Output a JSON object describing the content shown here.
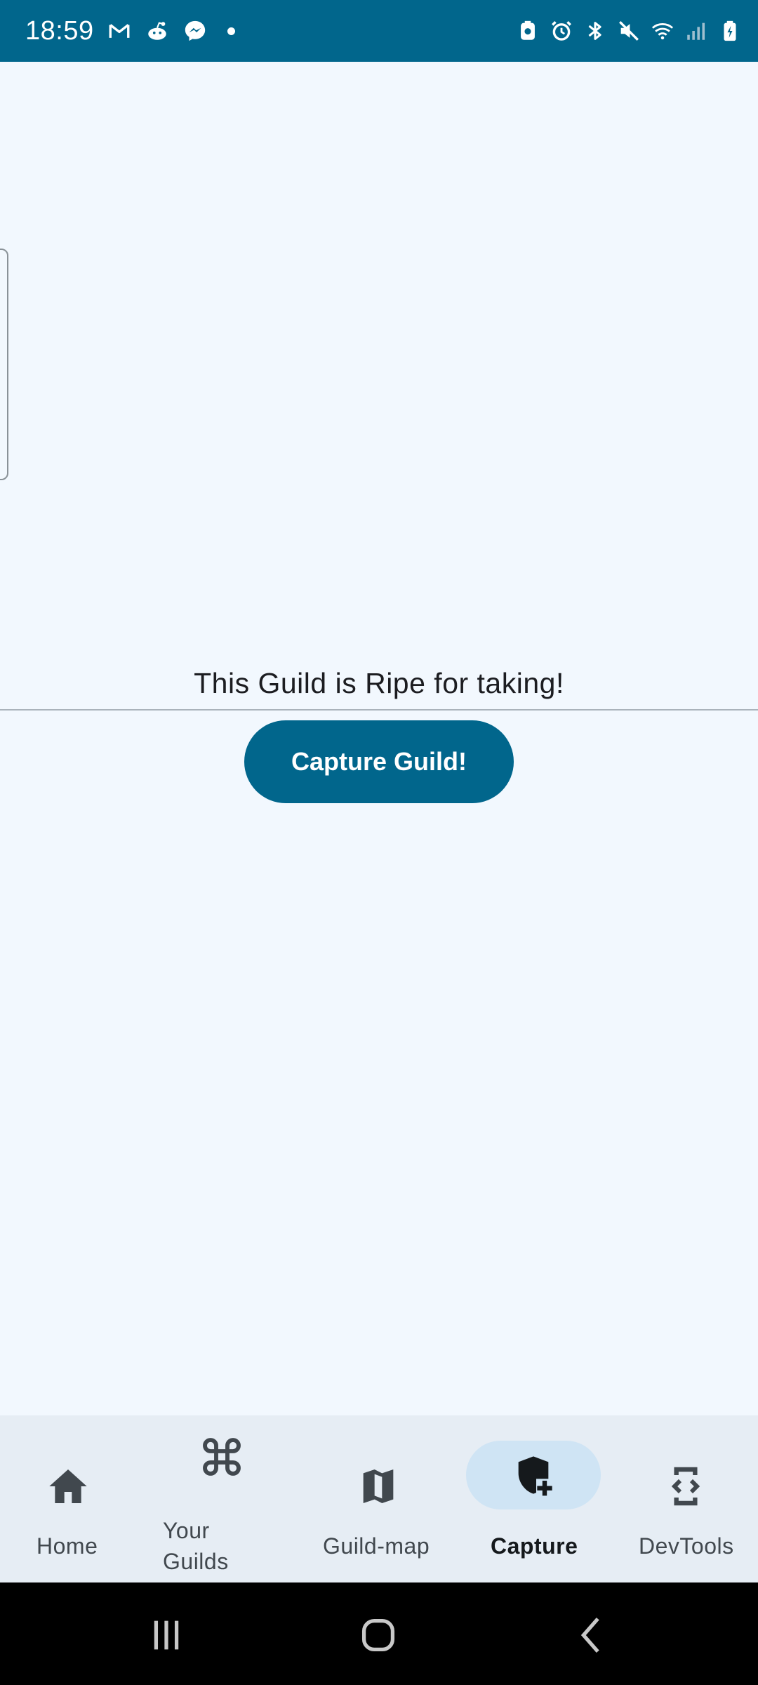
{
  "status_bar": {
    "time": "18:59",
    "left_icons": [
      "gmail-icon",
      "reddit-icon",
      "messenger-icon",
      "notification-dot-icon"
    ],
    "right_icons": [
      "screenshot-icon",
      "alarm-icon",
      "bluetooth-icon",
      "mute-icon",
      "wifi-icon",
      "signal-icon",
      "battery-charging-icon"
    ],
    "background": "#01668c"
  },
  "main": {
    "message": "This Guild is Ripe for taking!",
    "capture_button_label": "Capture Guild!",
    "accent_color": "#01668c"
  },
  "bottom_nav": {
    "items": [
      {
        "label": "Home",
        "icon": "home-icon",
        "active": false
      },
      {
        "label": "Your Guilds",
        "icon": "command-icon",
        "active": false
      },
      {
        "label": "Guild-map",
        "icon": "map-icon",
        "active": false
      },
      {
        "label": "Capture",
        "icon": "shield-plus-icon",
        "active": true
      },
      {
        "label": "DevTools",
        "icon": "devtools-icon",
        "active": false
      }
    ]
  },
  "system_nav": {
    "buttons": [
      "recents-icon",
      "home-circle-icon",
      "back-icon"
    ]
  }
}
